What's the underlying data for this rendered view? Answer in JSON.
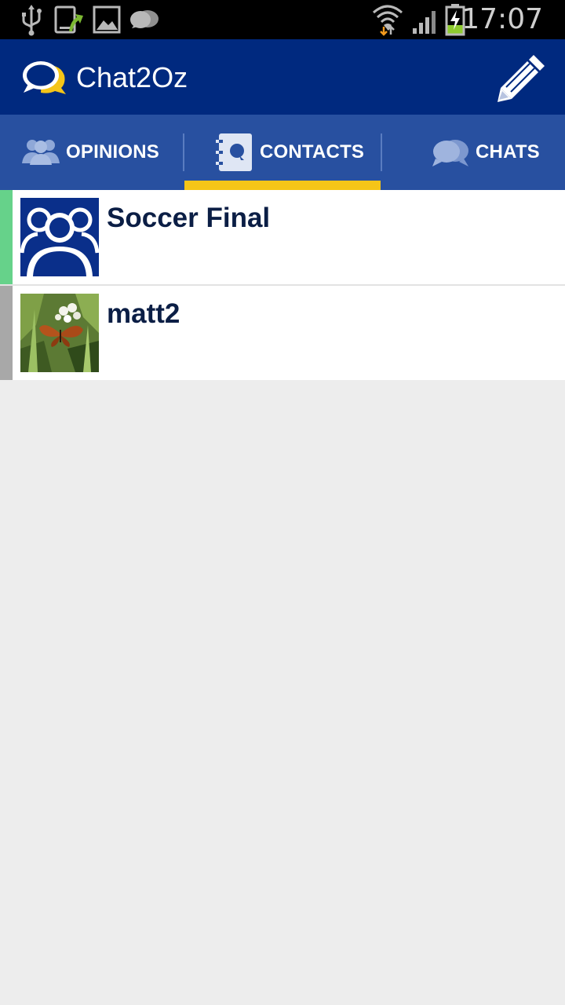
{
  "status_bar": {
    "time": "17:07",
    "icons": [
      "usb-icon",
      "phone-update-icon",
      "image-icon",
      "chat-notification-icon",
      "wifi-icon",
      "signal-icon",
      "battery-charging-icon"
    ]
  },
  "app_bar": {
    "title": "Chat2Oz",
    "logo_icon": "chat-bubbles-logo-icon",
    "compose_icon": "pencil-icon"
  },
  "tabs": [
    {
      "label": "OPINIONS",
      "icon": "people-icon",
      "selected": false
    },
    {
      "label": "CONTACTS",
      "icon": "contacts-book-icon",
      "selected": true
    },
    {
      "label": "CHATS",
      "icon": "chat-bubbles-icon",
      "selected": false
    }
  ],
  "contacts": [
    {
      "name": "Soccer Final",
      "avatar": "group-avatar-icon",
      "status_color": "#66d28a"
    },
    {
      "name": "matt2",
      "avatar": "butterfly-photo",
      "status_color": "#a8a8a8"
    }
  ],
  "colors": {
    "status_bar": "#000000",
    "app_bar": "#00297f",
    "tab_bar": "#2850a0",
    "tab_indicator": "#f5c518",
    "background": "#ededed",
    "contact_name": "#0b1e45"
  }
}
